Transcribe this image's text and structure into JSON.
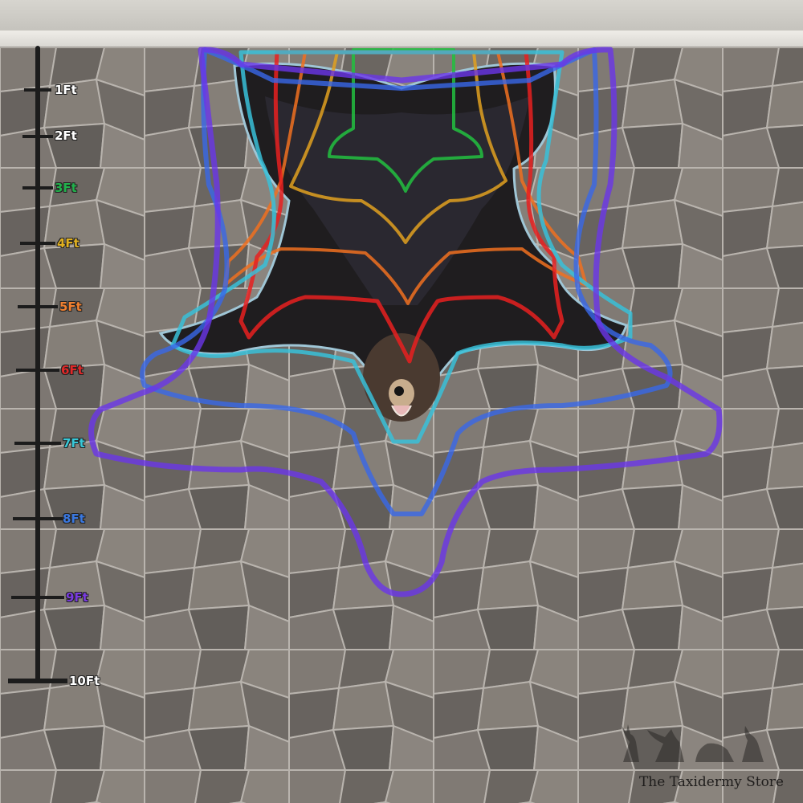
{
  "ruler": {
    "labels": [
      "1Ft",
      "2Ft",
      "3Ft",
      "4Ft",
      "5Ft",
      "6Ft",
      "7Ft",
      "8Ft",
      "9Ft",
      "10Ft"
    ],
    "label_colors": [
      "#ffffff",
      "#ffffff",
      "#22b14c",
      "#e0b020",
      "#f08030",
      "#e02828",
      "#38c8d8",
      "#3a78e0",
      "#7a3ce0",
      "#ffffff"
    ]
  },
  "outlines": [
    {
      "size": "3Ft",
      "color": "#22c040"
    },
    {
      "size": "4Ft",
      "color": "#e0a020"
    },
    {
      "size": "5Ft",
      "color": "#f07020"
    },
    {
      "size": "6Ft",
      "color": "#e82020"
    },
    {
      "size": "7Ft",
      "color": "#38c0d8"
    },
    {
      "size": "8Ft",
      "color": "#3868e8"
    },
    {
      "size": "9Ft",
      "color": "#6a36e8"
    }
  ],
  "subject": "black-bear-rug",
  "watermark": {
    "text": "The Taxidermy Store"
  }
}
